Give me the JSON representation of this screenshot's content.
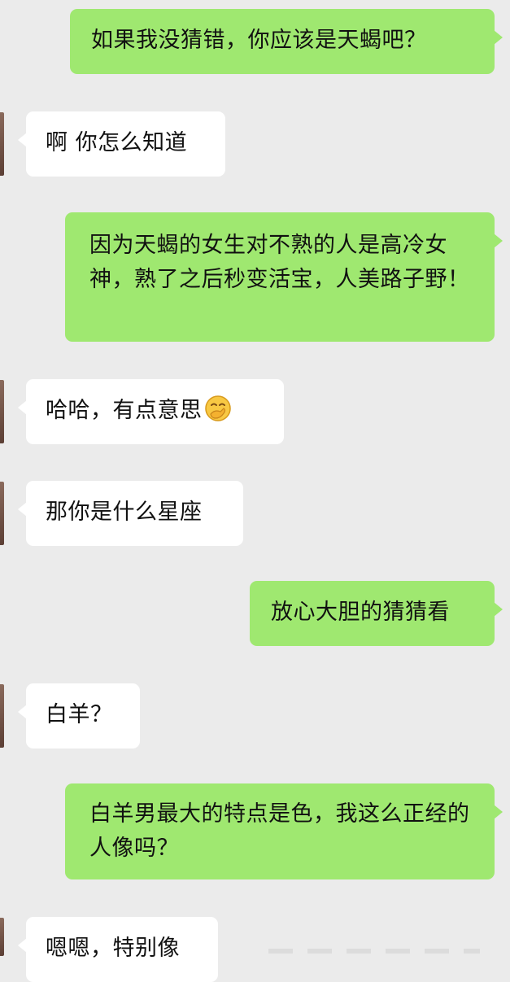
{
  "messages": [
    {
      "side": "out",
      "text": "如果我没猜错，你应该是天蝎吧？"
    },
    {
      "side": "in",
      "text": "啊 你怎么知道"
    },
    {
      "side": "out",
      "text": "因为天蝎的女生对不熟的人是高冷女神，熟了之后秒变活宝，人美路子野！"
    },
    {
      "side": "in",
      "text": "哈哈，有点意思",
      "emoji": "hand-over-mouth-emoji"
    },
    {
      "side": "in",
      "text": "那你是什么星座"
    },
    {
      "side": "out",
      "text": "放心大胆的猜猜看"
    },
    {
      "side": "in",
      "text": "白羊？"
    },
    {
      "side": "out",
      "text": "白羊男最大的特点是色，我这么正经的人像吗？"
    },
    {
      "side": "in",
      "text": "嗯嗯，特别像"
    }
  ],
  "colors": {
    "background": "#ebebeb",
    "outgoing_bubble": "#9fe870",
    "incoming_bubble": "#ffffff"
  }
}
